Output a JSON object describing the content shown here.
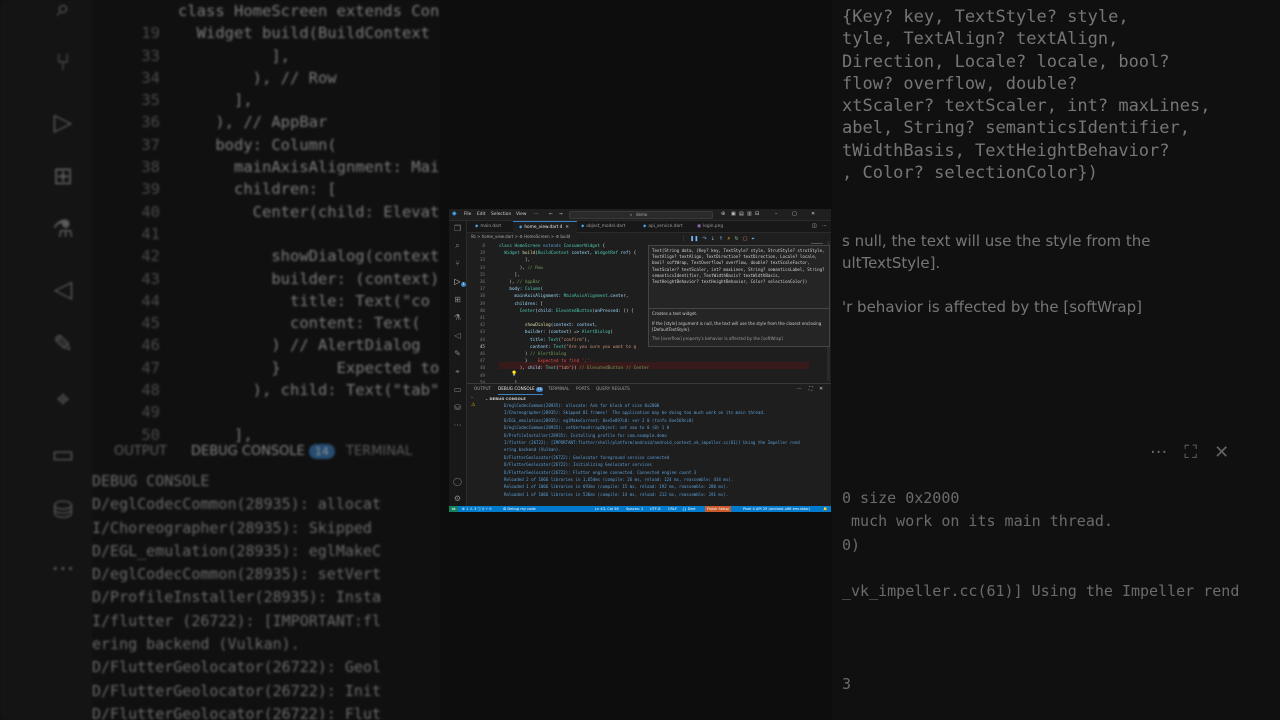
{
  "background": {
    "left_code": [
      {
        "ln": "",
        "text": "class HomeScreen extends Consu"
      },
      {
        "ln": "19",
        "text": "  Widget build(BuildContext co"
      },
      {
        "ln": "33",
        "text": "          ],"
      },
      {
        "ln": "34",
        "text": "        ), // Row"
      },
      {
        "ln": "35",
        "text": "      ],"
      },
      {
        "ln": "36",
        "text": "    ), // AppBar"
      },
      {
        "ln": "37",
        "text": "    body: Column("
      },
      {
        "ln": "38",
        "text": "      mainAxisAlignment: Mai"
      },
      {
        "ln": "39",
        "text": "      children: ["
      },
      {
        "ln": "40",
        "text": "        Center(child: Elevat"
      },
      {
        "ln": "41",
        "text": ""
      },
      {
        "ln": "42",
        "text": "          showDialog(context"
      },
      {
        "ln": "43",
        "text": "          builder: (context)"
      },
      {
        "ln": "44",
        "text": "            title: Text(\"co"
      },
      {
        "ln": "45",
        "text": "            content: Text("
      },
      {
        "ln": "46",
        "text": "          ) // AlertDialog"
      },
      {
        "ln": "47",
        "text": "          }      Expected to f"
      },
      {
        "ln": "48",
        "text": "        ), child: Text(\"tab\""
      },
      {
        "ln": "49",
        "text": ""
      },
      {
        "ln": "50",
        "text": "      ],"
      }
    ],
    "tabs": {
      "output": "OUTPUT",
      "debug_console": "DEBUG CONSOLE",
      "debug_count": "14",
      "terminal": "TERMINAL"
    },
    "left_log": [
      "DEBUG CONSOLE",
      "D/eglCodecCommon(28935): allocat",
      "I/Choreographer(28935): Skipped",
      "D/EGL_emulation(28935): eglMakeC",
      "D/eglCodecCommon(28935): setVert",
      "D/ProfileInstaller(28935): Insta",
      "I/flutter (26722): [IMPORTANT:fl",
      "ering backend (Vulkan).",
      "D/FlutterGeolocator(26722): Geol",
      "D/FlutterGeolocator(26722): Init",
      "D/FlutterGeolocator(26722): Flut"
    ],
    "right_text": [
      "{Key? key, TextStyle? style,",
      "tyle, TextAlign? textAlign,",
      "Direction, Locale? locale, bool?",
      "flow? overflow, double?",
      "xtScaler? textScaler, int? maxLines,",
      "abel, String? semanticsIdentifier,",
      "tWidthBasis, TextHeightBehavior?",
      ", Color? selectionColor})"
    ],
    "right_doc": [
      "s null, the text will use the style from the",
      "ultTextStyle].",
      "",
      "'r behavior is affected by the [softWrap]"
    ],
    "right_log": [
      "0 size 0x2000",
      " much work on its main thread.",
      "0)",
      "",
      "_vk_impeller.cc(61)] Using the Impeller rend",
      "",
      "",
      "",
      "3"
    ]
  },
  "titlebar": {
    "menus": [
      "File",
      "Edit",
      "Selection",
      "View",
      "···"
    ],
    "search": "demo"
  },
  "tabs": [
    {
      "label": "main.dart",
      "active": false
    },
    {
      "label": "home_view.dart 4",
      "active": true
    },
    {
      "label": "object_model.dart",
      "active": false
    },
    {
      "label": "api_service.dart",
      "active": false
    },
    {
      "label": "login.png",
      "active": false
    }
  ],
  "breadcrumb": "lib > home_view.dart > ⚙ HomeScreen > ⚙ build",
  "code": [
    {
      "ln": "8",
      "html": "<span class=\"kw\">class</span> <span class=\"kw\">HomeScreen</span> <span class=\"bl\">extends</span> <span class=\"kw\">ConsumerWidget</span> {"
    },
    {
      "ln": "19",
      "html": "  <span class=\"kw\">Widget</span> <span class=\"fn\">build</span>(<span class=\"kw\">BuildContext</span> <span class=\"pr\">context</span>, <span class=\"kw\">WidgetRef</span> <span class=\"pr\">ref</span>) {"
    },
    {
      "ln": "33",
      "html": "          ],"
    },
    {
      "ln": "34",
      "html": "        ), <span class=\"cm\">// Row</span>"
    },
    {
      "ln": "35",
      "html": "      ],"
    },
    {
      "ln": "36",
      "html": "    ), <span class=\"cm\">// AppBar</span>"
    },
    {
      "ln": "37",
      "html": "    <span class=\"pr\">body</span>: <span class=\"kw\">Column</span>("
    },
    {
      "ln": "38",
      "html": "      <span class=\"pr\">mainAxisAlignment</span>: <span class=\"kw\">MainAxisAlignment</span>.<span class=\"pr\">center</span>,"
    },
    {
      "ln": "39",
      "html": "      <span class=\"pr\">children</span>: ["
    },
    {
      "ln": "40",
      "html": "        <span class=\"kw\">Center</span>(<span class=\"pr\">child</span>: <span class=\"kw\">ElevatedButton</span>(<span class=\"pr\">onPressed</span>: () {"
    },
    {
      "ln": "41",
      "html": ""
    },
    {
      "ln": "42",
      "html": "          <span class=\"fn\">showDialog</span>(<span class=\"pr\">context</span>: <span class=\"pr\">context</span>,"
    },
    {
      "ln": "43",
      "html": "          <span class=\"pr\">builder</span>: (<span class=\"pr\">context</span>) =&gt; <span class=\"kw\">AlertDialog</span>("
    },
    {
      "ln": "44",
      "html": "            <span class=\"pr\">title</span>: <span class=\"kw\">Text</span>(<span class=\"st\">\"confirm\"</span>),"
    },
    {
      "ln": "45",
      "html": "            <span class=\"pr\">content</span>: <span class=\"kw\">Text</span>(<span class=\"st\">\"Are you sure you want to g</span>"
    },
    {
      "ln": "46",
      "html": "          ) <span class=\"cm\">// AlertDialog</span>"
    },
    {
      "ln": "47",
      "html": "          }    <span class=\"er\">Expected to find ';'.</span>"
    },
    {
      "ln": "48",
      "html": "        ), <span class=\"pr\">child</span>: <span class=\"kw\">Text</span>(<span class=\"st\">\"tab\"</span>)) <span class=\"cm\">// ElevatedButton // Center</span>"
    },
    {
      "ln": "49",
      "html": ""
    },
    {
      "ln": "50",
      "html": "      ],"
    }
  ],
  "hover": {
    "signature": "Text(String data, {Key? key, TextStyle? style, StrutStyle? strutStyle, TextAlign? textAlign, TextDirection? textDirection, Locale? locale, bool? softWrap, TextOverflow? overflow, double? textScaleFactor, TextScaler? textScaler, int? maxLines, String? semanticsLabel, String? semanticsIdentifier, TextWidthBasis? textWidthBasis, TextHeightBehavior? textHeightBehavior, Color? selectionColor})",
    "doc1": "Creates a text widget.",
    "doc2": "If the [style] argument is null, the text will use the style from the closest enclosing [DefaultTextStyle].",
    "doc3": "The [overflow] property's behavior is affected by the [softWrap]"
  },
  "panel": {
    "tabs": [
      "OUTPUT",
      "DEBUG CONSOLE",
      "TERMINAL",
      "PORTS",
      "QUERY RESULTS"
    ],
    "debug_count": "14",
    "section": "DEBUG CONSOLE",
    "log": [
      "D/eglCodecCommon(28935): allocate: Ask for block of size 0x2000",
      "I/Choreographer(28935): Skipped 81 frames!  The application may be doing too much work on its main thread.",
      "D/EGL_emulation(28935): eglMakeCurrent: 0xe5e897c0: ver 2 0 (tinfo 0xe569cc0)",
      "D/eglCodecCommon(28935): setVertexArrayObject: set vao to 0 (0) 1 0",
      "D/ProfileInstaller(28935): Installing profile for com.example.demo",
      "I/flutter (26722): [IMPORTANT:flutter/shell/platform/android/android_context_vk_impeller.cc(61)] Using the Impeller rend",
      "ering backend (Vulkan).",
      "D/FlutterGeolocator(26722): Geolocator foreground service connected",
      "D/FlutterGeolocator(26722): Initializing Geolocator services",
      "D/FlutterGeolocator(26722): Flutter engine connected. Connected engine count 3",
      "Reloaded 2 of 1066 libraries in 1,654ms (compile: 26 ms, reload: 124 ms, reassemble: 434 ms).",
      "Reloaded 1 of 1066 libraries in 693ms (compile: 15 ms, reload: 192 ms, reassemble: 280 ms).",
      "Reloaded 1 of 1066 libraries in 536ms (compile: 14 ms, reload: 212 ms, reassemble: 191 ms)."
    ]
  },
  "statusbar": {
    "problems": "⊗ 1 ⚠ 3 ⓘ 0  ⚡ 0",
    "debug": "Debug my code",
    "position": "Ln 43, Col 56",
    "spaces": "Spaces: 2",
    "encoding": "UTF-8",
    "eol": "CRLF",
    "language": "{} Dart",
    "setup": "Finish Setup",
    "device": "Pixel 4 API 29 (android-x86 emulator)"
  },
  "colors": {
    "accent": "#007acc",
    "error": "#f44747",
    "warning": "#ffcc00",
    "log": "#5c9fd6"
  }
}
